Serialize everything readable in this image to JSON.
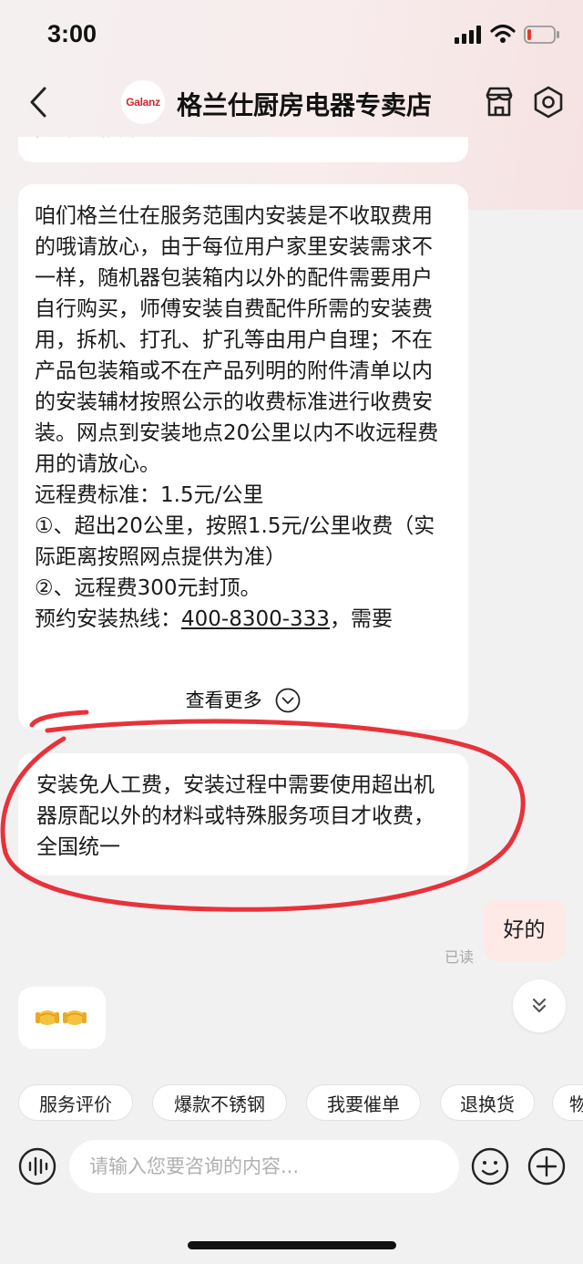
{
  "status_bar": {
    "time": "3:00",
    "battery_color": "#e53b2f"
  },
  "header": {
    "logo_text": "Galanz",
    "store_name": "格兰仕厨房电器专卖店",
    "icons": [
      "back-icon",
      "shop-icon",
      "settings-icon"
    ]
  },
  "chat": {
    "previous_bubble_partial": "能为您服务的呢？",
    "main_message": {
      "text": "咱们格兰仕在服务范围内安装是不收取费用的哦请放心，由于每位用户家里安装需求不一样，随机器包装箱内以外的配件需要用户自行购买，师傅安装自费配件所需的安装费用，拆机、打孔、扩孔等由用户自理；不在产品包装箱或不在产品列明的附件清单以内的安装辅材按照公示的收费标准进行收费安装。网点到安装地点20公里以内不收远程费用的请放心。\n远程费标准：1.5元/公里\n①、超出20公里，按照1.5元/公里收费（实际距离按照网点提供为准）\n②、远程费300元封顶。",
      "hotline_label": "预约安装热线：",
      "hotline_number": "400-8300-333",
      "hotline_suffix": "，需要",
      "see_more": "查看更多"
    },
    "reply_message": " 安装免人工费，安装过程中需要使用超出机器原配以外的材料或特殊服务项目才收费，全国统一",
    "my_message": "好的",
    "read_status": "已读",
    "emoji_message": "🤝🤝",
    "annotation_color": "#e8323a"
  },
  "quick_replies": [
    "服务评价",
    "爆款不锈钢",
    "我要催单",
    "退换货",
    "物"
  ],
  "input": {
    "placeholder": "请输入您要咨询的内容..."
  }
}
